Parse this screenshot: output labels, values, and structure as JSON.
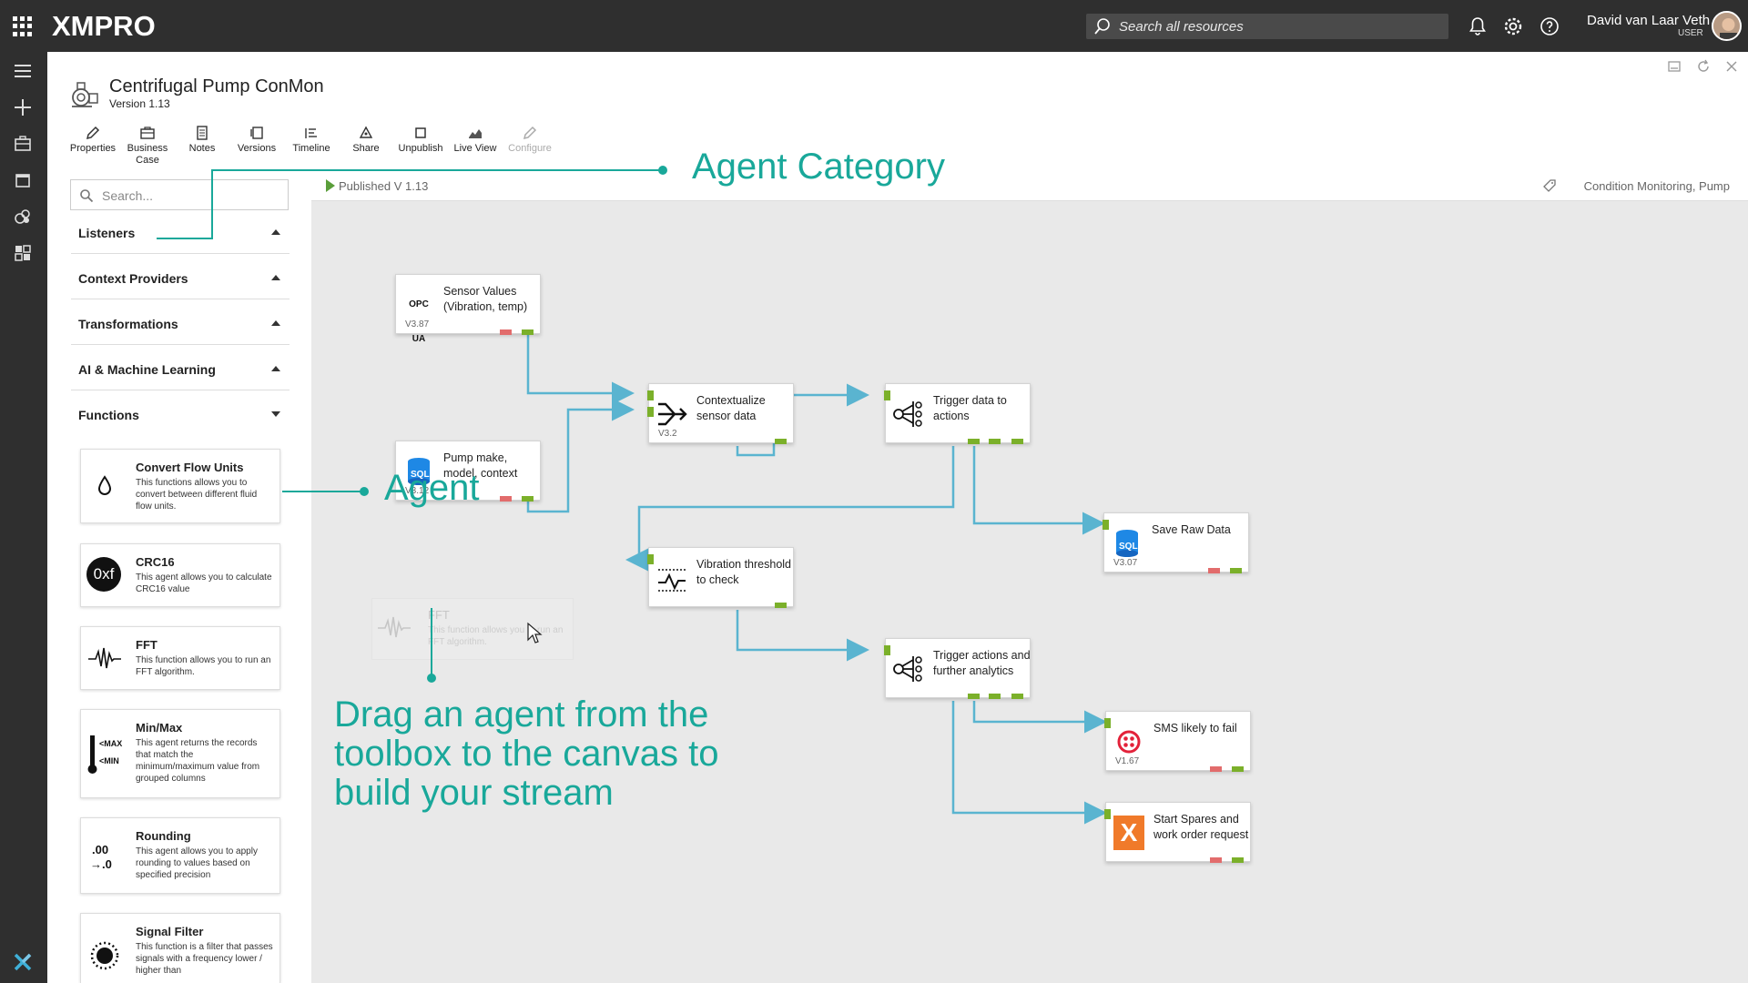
{
  "header": {
    "logo": "XMPRO",
    "search_placeholder": "Search all resources",
    "user_name": "David van Laar Veth",
    "user_role": "USER"
  },
  "page": {
    "title": "Centrifugal Pump ConMon",
    "version": "Version 1.13"
  },
  "toolbar": {
    "items": [
      {
        "label": "Properties",
        "icon": "pencil-icon"
      },
      {
        "label": "Business Case",
        "icon": "briefcase-icon"
      },
      {
        "label": "Notes",
        "icon": "notes-icon"
      },
      {
        "label": "Versions",
        "icon": "versions-icon"
      },
      {
        "label": "Timeline",
        "icon": "timeline-icon"
      },
      {
        "label": "Share",
        "icon": "share-icon"
      },
      {
        "label": "Unpublish",
        "icon": "square-icon"
      },
      {
        "label": "Live View",
        "icon": "chart-icon"
      },
      {
        "label": "Configure",
        "icon": "pencil-icon"
      }
    ]
  },
  "toolbox": {
    "search_placeholder": "Search...",
    "categories": [
      {
        "label": "Listeners",
        "state": "collapsed"
      },
      {
        "label": "Context Providers",
        "state": "collapsed"
      },
      {
        "label": "Transformations",
        "state": "collapsed"
      },
      {
        "label": "AI & Machine Learning",
        "state": "collapsed"
      },
      {
        "label": "Functions",
        "state": "expanded"
      }
    ],
    "agents": [
      {
        "name": "Convert Flow Units",
        "desc": "This functions allows you to convert between different fluid flow units.",
        "icon": "droplet-icon"
      },
      {
        "name": "CRC16",
        "desc": "This agent allows you to calculate CRC16 value",
        "icon": "hex-badge-icon",
        "badge": "0xf"
      },
      {
        "name": "FFT",
        "desc": "This function allows you to run an FFT algorithm.",
        "icon": "waveform-icon"
      },
      {
        "name": "Min/Max",
        "desc": "This agent returns the records that match the minimum/maximum value from grouped columns",
        "icon": "thermometer-icon",
        "max": "<MAX",
        "min": "<MIN"
      },
      {
        "name": "Rounding",
        "desc": "This agent allows you to apply rounding to values based on specified precision",
        "icon": "rounding-icon",
        "glyph": ".00 →.0"
      },
      {
        "name": "Signal Filter",
        "desc": "This function is a filter that passes signals with a frequency lower / higher than",
        "icon": "dial-icon"
      }
    ]
  },
  "canvas": {
    "published": "Published V 1.13",
    "tags": "Condition Monitoring, Pump",
    "nodes": [
      {
        "id": "sensor",
        "label": "Sensor Values (Vibration, temp)",
        "version": "V3.87",
        "icon": "opc-ua-icon",
        "icon_text": "OPC UA"
      },
      {
        "id": "pump",
        "label": "Pump make, model, context",
        "version": "V3.12",
        "icon": "sql-icon",
        "icon_text": "SQL"
      },
      {
        "id": "contextualize",
        "label": "Contextualize sensor data",
        "version": "V3.2",
        "icon": "merge-icon"
      },
      {
        "id": "trigger1",
        "label": "Trigger data to actions",
        "version": "",
        "icon": "network-icon"
      },
      {
        "id": "vibration",
        "label": "Vibration threshold to check",
        "version": "",
        "icon": "threshold-icon"
      },
      {
        "id": "saveraw",
        "label": "Save Raw Data",
        "version": "V3.07",
        "icon": "sql-icon",
        "icon_text": "SQL"
      },
      {
        "id": "trigger2",
        "label": "Trigger actions and further analytics",
        "version": "",
        "icon": "network-icon"
      },
      {
        "id": "sms",
        "label": "SMS likely to fail",
        "version": "V1.67",
        "icon": "twilio-icon"
      },
      {
        "id": "spares",
        "label": "Start Spares and work order request",
        "version": "",
        "icon": "x-app-icon",
        "icon_text": "X"
      }
    ],
    "ghost": {
      "name": "FFT",
      "desc": "This function allows you to run an FFT algorithm."
    }
  },
  "annotations": {
    "category": "Agent Category",
    "agent": "Agent",
    "drag": [
      "Drag an agent from the",
      "toolbox to the canvas to",
      "build your stream"
    ]
  },
  "colors": {
    "topbar": "#2f2f2f",
    "annotation": "#19a89a",
    "connector": "#5ab4d0",
    "port_green": "#7bb02a",
    "port_red": "#e26c6c"
  }
}
